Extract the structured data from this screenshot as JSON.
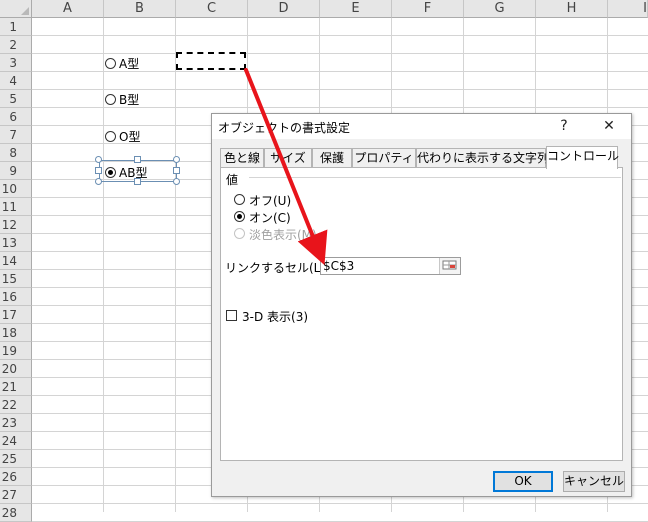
{
  "sheet": {
    "columns": [
      "A",
      "B",
      "C",
      "D",
      "E",
      "F",
      "G",
      "H",
      "I"
    ],
    "rows": [
      "1",
      "2",
      "3",
      "4",
      "5",
      "6",
      "7",
      "8",
      "9",
      "10",
      "11",
      "12",
      "13",
      "14",
      "15",
      "16",
      "17",
      "18",
      "19",
      "20",
      "21",
      "22",
      "23",
      "24",
      "25",
      "26",
      "27",
      "28"
    ]
  },
  "options": {
    "a": "A型",
    "b": "B型",
    "o": "O型",
    "ab": "AB型",
    "selected": "ab"
  },
  "dialog": {
    "title": "オブジェクトの書式設定",
    "help_icon": "?",
    "close_icon": "✕",
    "tabs": [
      "色と線",
      "サイズ",
      "保護",
      "プロパティ",
      "代わりに表示する文字列",
      "コントロール"
    ],
    "active_tab": "コントロール",
    "value_group_label": "値",
    "radio_off": "オフ(U)",
    "radio_on": "オン(C)",
    "radio_mixed": "淡色表示(M)",
    "radio_selected": "オン(C)",
    "link_cell_label": "リンクするセル(L):",
    "link_cell_value": "$C$3",
    "checkbox_3d": "3-D 表示(3)",
    "ok": "OK",
    "cancel": "キャンセル"
  },
  "colors": {
    "arrow": "#e8141b",
    "selection_handle": "#6b8fb3",
    "default_button_border": "#0078d7"
  }
}
